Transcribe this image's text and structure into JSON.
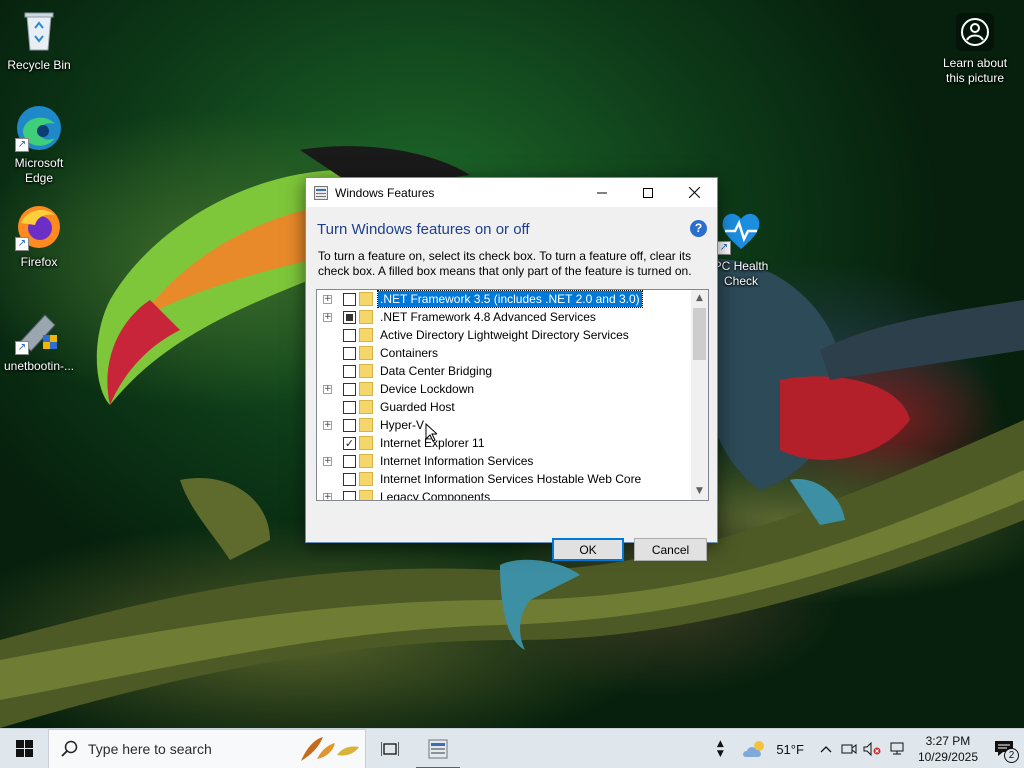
{
  "desktop": {
    "icons": [
      {
        "label": "Recycle Bin",
        "icon": "recycle-bin-icon"
      },
      {
        "label": "Microsoft Edge",
        "icon": "edge-icon"
      },
      {
        "label": "Firefox",
        "icon": "firefox-icon"
      },
      {
        "label": "unetbootin-...",
        "icon": "unetbootin-icon"
      },
      {
        "label": "PC Health Check",
        "icon": "pc-health-check-icon"
      },
      {
        "label": "Learn about this picture",
        "icon": "camera-icon"
      }
    ]
  },
  "window": {
    "title": "Windows Features",
    "heading": "Turn Windows features on or off",
    "help_glyph": "?",
    "description": "To turn a feature on, select its check box. To turn a feature off, clear its check box. A filled box means that only part of the feature is turned on.",
    "features": [
      {
        "label": ".NET Framework 3.5 (includes .NET 2.0 and 3.0)",
        "expandable": true,
        "state": "unchecked",
        "selected": true
      },
      {
        "label": ".NET Framework 4.8 Advanced Services",
        "expandable": true,
        "state": "partial",
        "selected": false
      },
      {
        "label": "Active Directory Lightweight Directory Services",
        "expandable": false,
        "state": "unchecked",
        "selected": false
      },
      {
        "label": "Containers",
        "expandable": false,
        "state": "unchecked",
        "selected": false
      },
      {
        "label": "Data Center Bridging",
        "expandable": false,
        "state": "unchecked",
        "selected": false
      },
      {
        "label": "Device Lockdown",
        "expandable": true,
        "state": "unchecked",
        "selected": false
      },
      {
        "label": "Guarded Host",
        "expandable": false,
        "state": "unchecked",
        "selected": false
      },
      {
        "label": "Hyper-V",
        "expandable": true,
        "state": "unchecked",
        "selected": false
      },
      {
        "label": "Internet Explorer 11",
        "expandable": false,
        "state": "checked",
        "selected": false
      },
      {
        "label": "Internet Information Services",
        "expandable": true,
        "state": "unchecked",
        "selected": false
      },
      {
        "label": "Internet Information Services Hostable Web Core",
        "expandable": false,
        "state": "unchecked",
        "selected": false
      },
      {
        "label": "Legacy Components",
        "expandable": true,
        "state": "unchecked",
        "selected": false
      }
    ],
    "ok_label": "OK",
    "cancel_label": "Cancel"
  },
  "taskbar": {
    "search_placeholder": "Type here to search",
    "weather_temp": "51°F",
    "time": "3:27 PM",
    "date": "10/29/2025",
    "notification_count": "2"
  },
  "colors": {
    "accent": "#0078d7",
    "heading": "#1f3f8e",
    "taskbar_bg": "#dfe6ec"
  }
}
